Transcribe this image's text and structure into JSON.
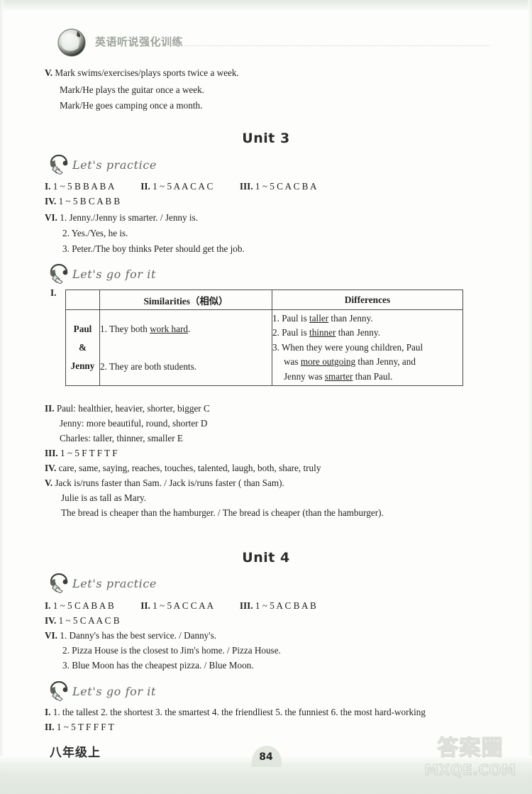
{
  "running_head": {
    "title": "英语听说强化训练",
    "globe_icon": "globe-icon"
  },
  "top_section": {
    "lines": [
      "V. Mark swims/exercises/plays sports twice a week.",
      "Mark/He plays the guitar once a week.",
      "Mark/He goes camping once a month."
    ],
    "marker": "V."
  },
  "unit3": {
    "title": "Unit 3",
    "practice": {
      "label": "Let's practice",
      "icon": "headphone-icon",
      "answers": [
        {
          "num": "I.",
          "text": "1 ~ 5 B  B  A  B  A"
        },
        {
          "num": "II.",
          "text": "1 ~ 5 A  A  C  A  C"
        },
        {
          "num": "III.",
          "text": "1 ~ 5 C  A  C  B  A"
        },
        {
          "num": "IV.",
          "text": "1 ~ 5 B  C  A  B  B"
        }
      ],
      "vi": {
        "num": "VI.",
        "items": [
          "1. Jenny./Jenny is smarter. / Jenny is.",
          "2. Yes./Yes, he is.",
          "3. Peter./The boy thinks Peter should get the job."
        ]
      }
    },
    "goforit": {
      "label": "Let's go for it",
      "icon": "headphone-icon",
      "table": {
        "marker": "I.",
        "headers": [
          "",
          "Similarities（相似）",
          "Differences"
        ],
        "row_label": [
          "Paul",
          "&",
          "Jenny"
        ],
        "similarities": [
          "1. They both work hard.",
          "2. They are both students."
        ],
        "similarities_underlined": [
          "work hard",
          ""
        ],
        "differences": [
          "1. Paul is taller than Jenny.",
          "2. Paul is thinner than Jenny.",
          "3. When they were young children, Paul",
          "was more outgoing than Jenny, and",
          "Jenny was smarter than Paul."
        ]
      },
      "section2": {
        "num": "II.",
        "lines": [
          "Paul: healthier, heavier, shorter, bigger    C",
          "Jenny: more beautiful, round, shorter    D",
          "Charles: taller, thinner, smaller    E"
        ]
      },
      "section3": {
        "num": "III.",
        "text": "1 ~ 5 F   T   F   T   F"
      },
      "section4": {
        "num": "IV.",
        "text": "care, same, saying, reaches, touches, talented, laugh, both, share, truly"
      },
      "section5": {
        "num": "V.",
        "lines": [
          "Jack is/runs faster than Sam. / Jack is/runs faster ( than Sam).",
          "Julie is as tall as Mary.",
          "The bread is cheaper than the hamburger. / The bread is cheaper (than the hamburger)."
        ]
      }
    }
  },
  "unit4": {
    "title": "Unit 4",
    "practice": {
      "label": "Let's practice",
      "icon": "headphone-icon",
      "answers": [
        {
          "num": "I.",
          "text": "1 ~ 5 C  A  B  A  B"
        },
        {
          "num": "II.",
          "text": "1 ~ 5 A  C  C  A  A"
        },
        {
          "num": "III.",
          "text": "1 ~ 5 A  C  B  A  B"
        },
        {
          "num": "IV.",
          "text": "1 ~ 5 C  A  A  C  B"
        }
      ],
      "vi": {
        "num": "VI.",
        "items": [
          "1. Danny's has the best service. / Danny's.",
          "2. Pizza House is the closest to Jim's home. / Pizza House.",
          "3. Blue Moon has the cheapest pizza. / Blue Moon."
        ]
      }
    },
    "goforit": {
      "label": "Let's go for it",
      "icon": "headphone-icon",
      "section1": {
        "num": "I.",
        "text": "1. the tallest     2. the shortest     3. the smartest     4. the friendliest     5. the funniest     6. the most hard-working"
      },
      "section2": {
        "num": "II.",
        "text": "1 ~ 5 T   F   F   F   T"
      }
    }
  },
  "footer": {
    "grade": "八年级上",
    "page_number": "84"
  },
  "watermark": {
    "chinese": "答案圈",
    "domain": "MXQE.COM"
  }
}
